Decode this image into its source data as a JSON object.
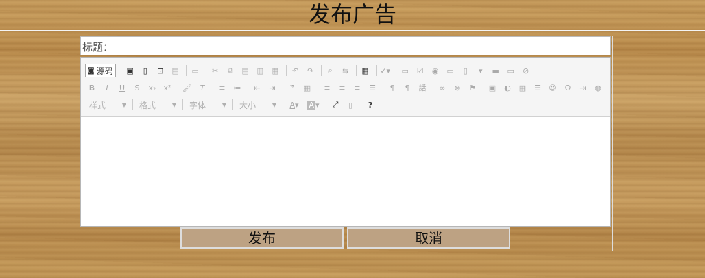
{
  "page": {
    "title": "发布广告"
  },
  "form": {
    "title_label": "标题：",
    "title_value": "",
    "content_value": ""
  },
  "toolbar": {
    "row1": {
      "source_label": "源码",
      "icons": [
        "save-icon",
        "new-page-icon",
        "preview-icon",
        "print-icon",
        "templates-icon",
        "cut-icon",
        "copy-icon",
        "paste-icon",
        "paste-text-icon",
        "paste-word-icon",
        "undo-icon",
        "redo-icon",
        "find-icon",
        "replace-icon",
        "select-all-icon",
        "spellcheck-icon",
        "form-icon",
        "checkbox-icon",
        "radio-icon",
        "textfield-icon",
        "textarea-icon",
        "select-icon",
        "button-icon",
        "image-button-icon",
        "hidden-field-icon"
      ]
    },
    "row2": {
      "icons": [
        "bold-icon",
        "italic-icon",
        "underline-icon",
        "strike-icon",
        "subscript-icon",
        "superscript-icon",
        "copy-format-icon",
        "remove-format-icon",
        "numbered-list-icon",
        "bulleted-list-icon",
        "outdent-icon",
        "indent-icon",
        "blockquote-icon",
        "div-icon",
        "align-left-icon",
        "align-center-icon",
        "align-right-icon",
        "justify-icon",
        "ltr-icon",
        "rtl-icon",
        "language-icon",
        "link-icon",
        "unlink-icon",
        "anchor-icon",
        "image-icon",
        "flash-icon",
        "table-icon",
        "horizontal-rule-icon",
        "smiley-icon",
        "special-char-icon",
        "page-break-icon",
        "iframe-icon"
      ]
    },
    "row3": {
      "combos": {
        "style": "样式",
        "format": "格式",
        "font": "字体",
        "size": "大小"
      },
      "text_color_label": "A",
      "bg_color_label": "A",
      "help_label": "?"
    }
  },
  "buttons": {
    "publish": "发布",
    "cancel": "取消"
  }
}
